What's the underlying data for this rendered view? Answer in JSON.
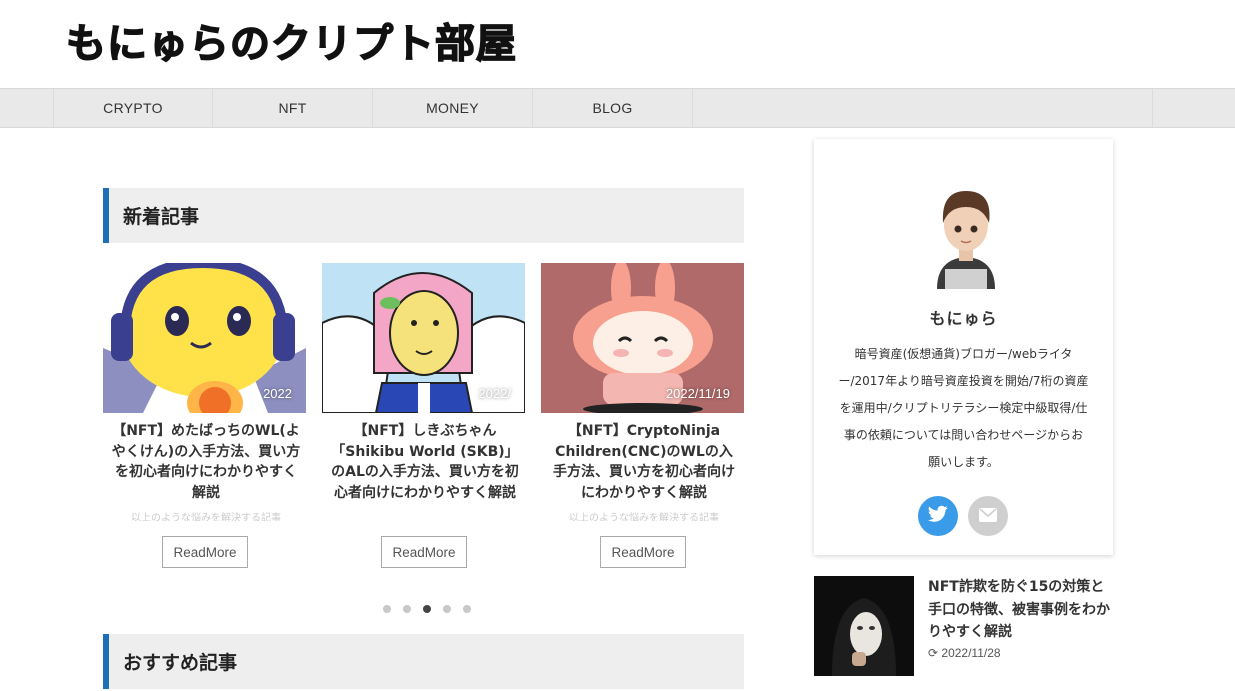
{
  "site": {
    "title": "もにゅらのクリプト部屋"
  },
  "nav": {
    "items": [
      "CRYPTO",
      "NFT",
      "MONEY",
      "BLOG"
    ]
  },
  "sections": {
    "new_articles": "新着記事",
    "recommended": "おすすめ記事"
  },
  "cards": [
    {
      "date": "2022",
      "title": "【NFT】めたばっちのWL(よやくけん)の入手方法、買い方を初心者向けにわかりやすく解説",
      "excerpt": "以上のような悩みを解決する記事",
      "readmore": "ReadMore"
    },
    {
      "date": "2022/",
      "title": "【NFT】しきぶちゃん「Shikibu World (SKB)」のALの入手方法、買い方を初心者向けにわかりやすく解説",
      "excerpt": "",
      "readmore": "ReadMore"
    },
    {
      "date": "2022/11/19",
      "title": "【NFT】CryptoNinja Children(CNC)のWLの入手方法、買い方を初心者向けにわかりやすく解説",
      "excerpt": "以上のような悩みを解決する記事",
      "readmore": "ReadMore"
    }
  ],
  "carousel": {
    "count": 5,
    "active": 3
  },
  "profile": {
    "name": "もにゅら",
    "bio": "暗号資産(仮想通貨)ブロガー/webライター/2017年より暗号資産投資を開始/7桁の資産を運用中/クリプトリテラシー検定中級取得/仕事の依頼については問い合わせページからお願いします。",
    "social": [
      "twitter-icon",
      "mail-icon"
    ]
  },
  "side_post": {
    "title": "NFT詐欺を防ぐ15の対策と手口の特徴、被害事例をわかりやすく解説",
    "date": "2022/11/28"
  },
  "colors": {
    "accent": "#1d6fb8",
    "twitter": "#3a9be8",
    "nav_bg": "#e9e9e9"
  }
}
